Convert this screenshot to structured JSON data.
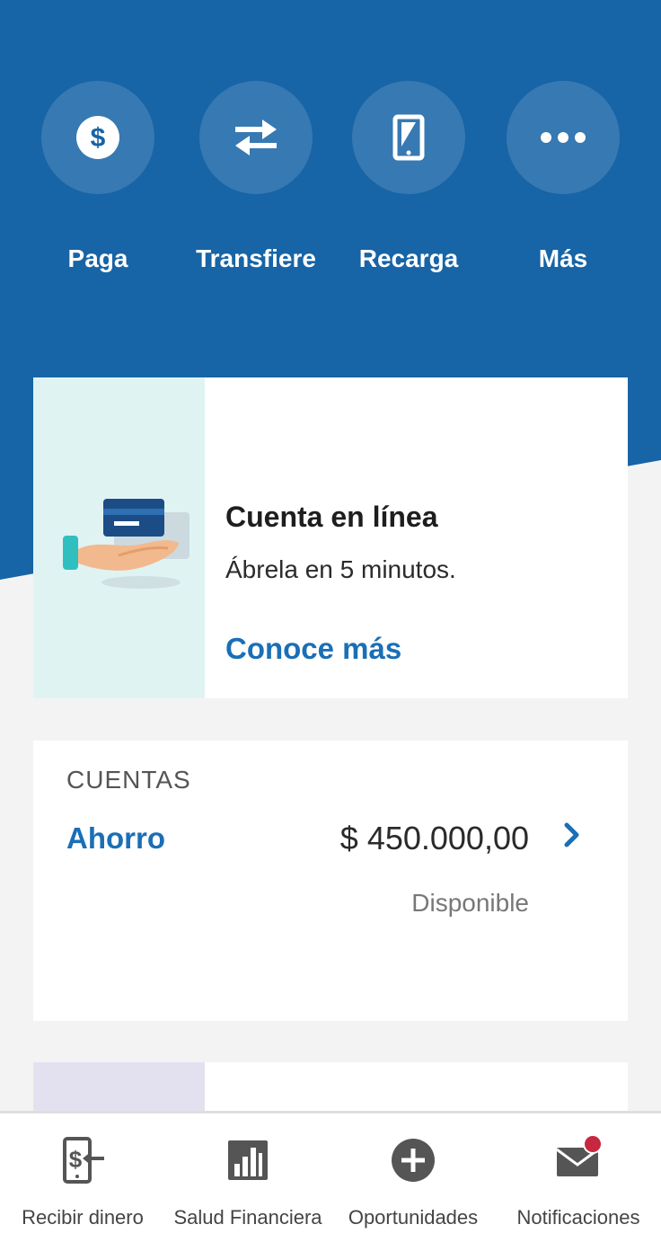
{
  "quick_actions": [
    {
      "label": "Paga",
      "icon": "dollar-icon"
    },
    {
      "label": "Transfiere",
      "icon": "transfer-arrows-icon"
    },
    {
      "label": "Recarga",
      "icon": "phone-icon"
    },
    {
      "label": "Más",
      "icon": "more-dots-icon"
    }
  ],
  "promo": {
    "title": "Cuenta en línea",
    "subtitle": "Ábrela en 5 minutos.",
    "link": "Conoce más"
  },
  "accounts": {
    "section_title": "CUENTAS",
    "items": [
      {
        "name": "Ahorro",
        "amount": "$ 450.000,00",
        "status": "Disponible"
      }
    ]
  },
  "bottom_nav": [
    {
      "label": "Recibir dinero",
      "icon": "receive-money-icon"
    },
    {
      "label": "Salud Financiera",
      "icon": "bar-chart-icon"
    },
    {
      "label": "Oportunidades",
      "icon": "plus-circle-icon"
    },
    {
      "label": "Notificaciones",
      "icon": "mail-icon"
    }
  ],
  "colors": {
    "brand_blue": "#1764a6",
    "link_blue": "#1a6fb6",
    "notification_dot": "#c8283f"
  }
}
